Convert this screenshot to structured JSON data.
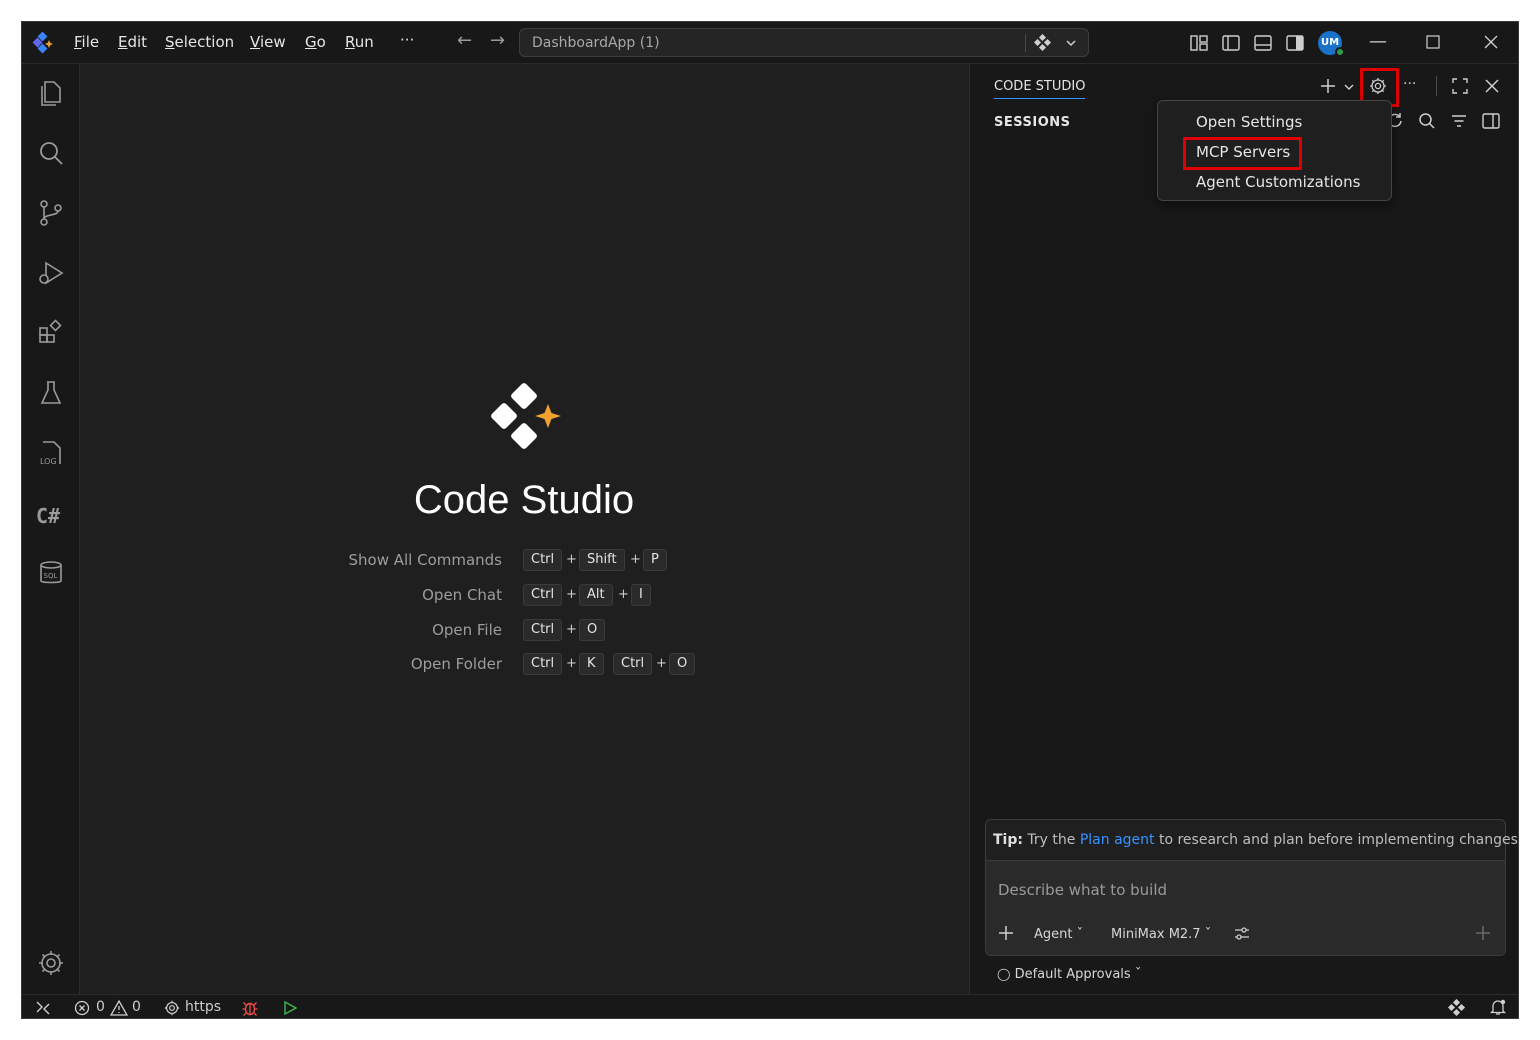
{
  "titlebar": {
    "menu": [
      {
        "label": "File",
        "u": "F",
        "rest": "ile"
      },
      {
        "label": "Edit",
        "u": "E",
        "rest": "dit"
      },
      {
        "label": "Selection",
        "u": "S",
        "rest": "election"
      },
      {
        "label": "View",
        "u": "V",
        "rest": "iew"
      },
      {
        "label": "Go",
        "u": "G",
        "rest": "o"
      },
      {
        "label": "Run",
        "u": "R",
        "rest": "un"
      }
    ],
    "more": "···",
    "search_text": "DashboardApp (1)",
    "avatar_initials": "UM"
  },
  "welcome": {
    "title": "Code Studio",
    "shortcuts": [
      {
        "label": "Show All Commands",
        "keys": [
          "Ctrl",
          "Shift",
          "P"
        ]
      },
      {
        "label": "Open Chat",
        "keys": [
          "Ctrl",
          "Alt",
          "I"
        ]
      },
      {
        "label": "Open File",
        "keys": [
          "Ctrl",
          "O"
        ]
      },
      {
        "label": "Open Folder",
        "keys": [
          "Ctrl",
          "K"
        ],
        "keys2": [
          "Ctrl",
          "O"
        ]
      }
    ]
  },
  "panel": {
    "title": "CODE STUDIO",
    "sessions_label": "SESSIONS",
    "dropdown": [
      "Open Settings",
      "MCP Servers",
      "Agent Customizations"
    ],
    "tip_prefix": "Tip:",
    "tip_before": " Try the ",
    "tip_link": "Plan agent",
    "tip_after": " to research and plan before implementing changes.",
    "input_placeholder": "Describe what to build",
    "agent_label": "Agent",
    "model_label": "MiniMax M2.7",
    "approvals_label": "Default Approvals"
  },
  "status": {
    "errors": "0",
    "warnings": "0",
    "remote_label": "https"
  },
  "colors": {
    "accent": "#3794ff",
    "highlight": "#e00000",
    "brand_star": "#f0a030"
  }
}
